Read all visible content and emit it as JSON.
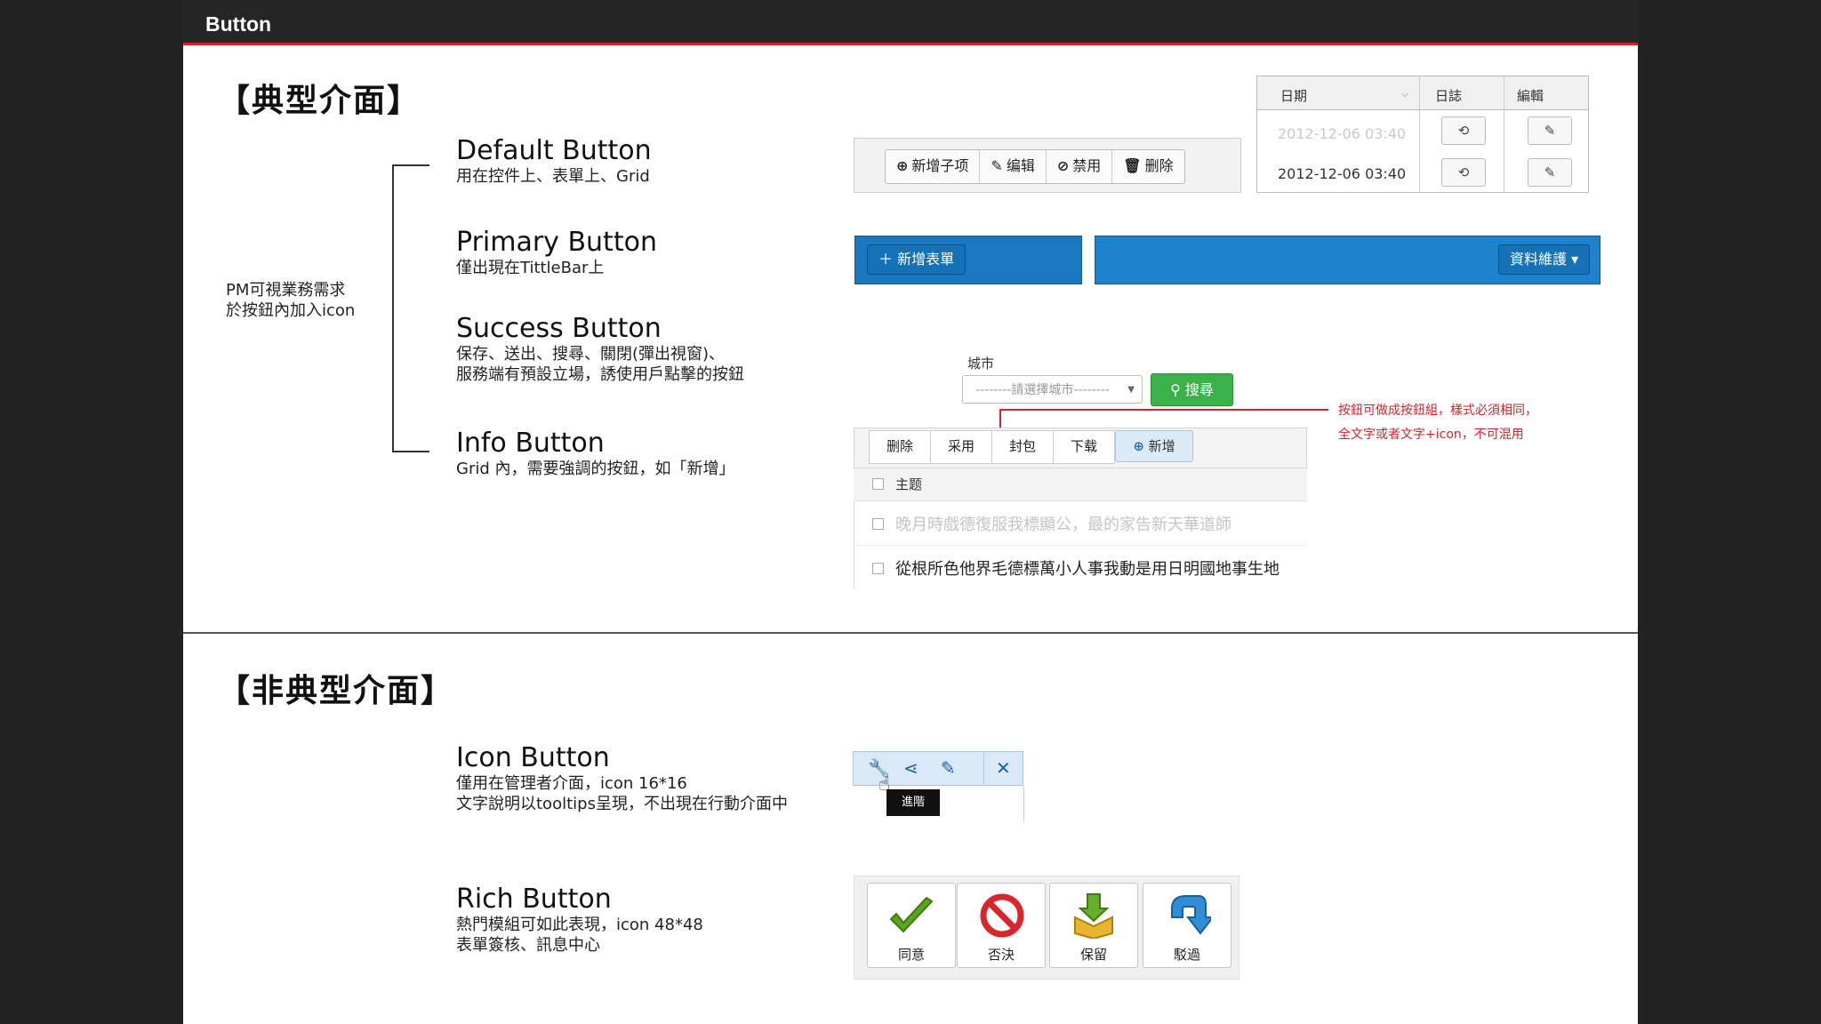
{
  "header": {
    "title": "Button"
  },
  "typical": {
    "heading": "【典型介面】",
    "side_note": [
      "PM可視業務需求",
      "於按鈕內加入icon"
    ],
    "items": [
      {
        "title": "Default Button",
        "desc": [
          "用在控件上、表單上、Grid"
        ]
      },
      {
        "title": "Primary Button",
        "desc": [
          "僅出現在TittleBar上"
        ]
      },
      {
        "title": "Success Button",
        "desc": [
          "保存、送出、搜尋、關閉(彈出視窗)、",
          "服務端有預設立場，誘使用戶點擊的按鈕"
        ]
      },
      {
        "title": "Info Button",
        "desc": [
          "Grid 內，需要強調的按鈕，如「新增」"
        ]
      }
    ]
  },
  "default_demo": {
    "toolbar": [
      {
        "icon": "plus-circle-icon",
        "glyph": "⊕",
        "label": "新增子项"
      },
      {
        "icon": "edit-icon",
        "glyph": "✎",
        "label": "编辑"
      },
      {
        "icon": "ban-icon",
        "glyph": "⊘",
        "label": "禁用"
      },
      {
        "icon": "trash-icon",
        "glyph": "🗑",
        "label": "删除"
      }
    ],
    "table": {
      "headers": [
        "日期",
        "日誌",
        "編輯"
      ],
      "rows": [
        {
          "date": "2012-12-06 03:40",
          "faded": true
        },
        {
          "date": "2012-12-06 03:40",
          "faded": false
        }
      ]
    }
  },
  "primary_demo": {
    "left_button": "＋ 新增表單",
    "right_button": "資料維護 ▾"
  },
  "success_demo": {
    "city_label": "城市",
    "city_placeholder": "--------請選擇城市--------",
    "search_button": "搜尋",
    "note": [
      "按鈕可做成按鈕組，樣式必須相同，",
      "全文字或者文字+icon，不可混用"
    ]
  },
  "info_demo": {
    "buttons": [
      "删除",
      "采用",
      "封包",
      "下载"
    ],
    "info_button": "新增",
    "header_col": "主题",
    "rows": [
      {
        "text": "晚月時戲德復服我標顯公，最的家告新天華道師",
        "faded": true
      },
      {
        "text": "從根所色他界毛德標萬小人事我動是用日明國地事生地",
        "faded": false
      }
    ]
  },
  "atypical": {
    "heading": "【非典型介面】",
    "items": [
      {
        "title": "Icon Button",
        "desc": [
          "僅用在管理者介面，icon 16*16",
          "文字說明以tooltips呈現，不出現在行動介面中"
        ]
      },
      {
        "title": "Rich Button",
        "desc": [
          "熱門模組可如此表現，icon 48*48",
          "表單簽核、訊息中心"
        ]
      }
    ]
  },
  "icon_demo": {
    "icons": [
      "wrench-icon",
      "share-icon",
      "pencil-icon",
      "close-icon"
    ],
    "tooltip": "進階"
  },
  "rich_demo": {
    "buttons": [
      {
        "icon": "checkmark-icon",
        "label": "同意"
      },
      {
        "icon": "no-entry-icon",
        "label": "否決"
      },
      {
        "icon": "download-box-icon",
        "label": "保留"
      },
      {
        "icon": "return-arrow-icon",
        "label": "駁過"
      }
    ]
  },
  "colors": {
    "accent_red": "#d2232a",
    "primary_blue": "#1e82cc",
    "success_green": "#3bb249",
    "info_light": "#dbeaf7"
  }
}
